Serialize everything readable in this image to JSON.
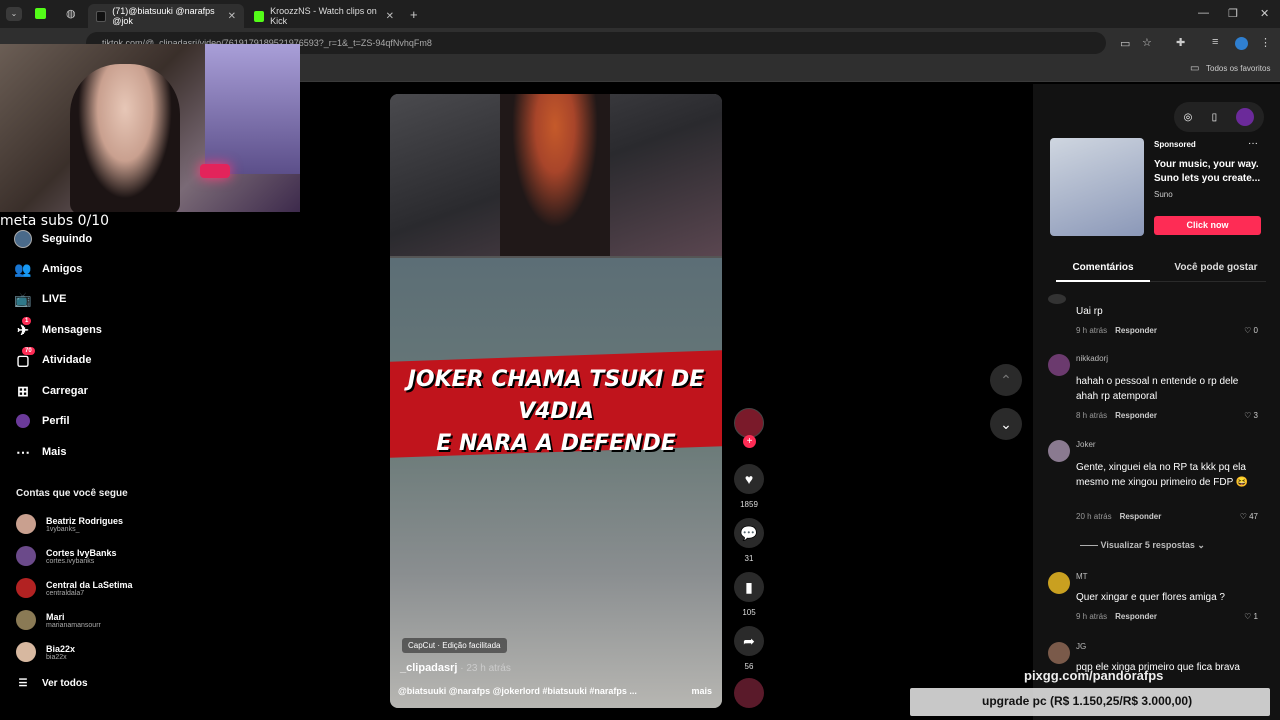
{
  "browser": {
    "tabs": [
      {
        "title": "(71)@biatsuuki @narafps @jok",
        "color": "#1b1b1b"
      },
      {
        "title": "KroozzNS - Watch clips on Kick",
        "color": "#53fc18"
      }
    ],
    "url": "tiktok.com/@_clipadasrj/video/7619179189521976593?_r=1&_t=ZS-94qfNvhqFm8",
    "bookmarks_label": "Todos os favoritos"
  },
  "overlay": {
    "subs_text": "meta subs 0/10",
    "domain_text": "pixgg.com/pandorafps",
    "upgrade_text": "upgrade pc (R$ 1.150,25/R$ 3.000,00)"
  },
  "sidebar": {
    "nav": [
      {
        "label": "Seguindo",
        "icon": "following-icon"
      },
      {
        "label": "Amigos",
        "icon": "friends-icon"
      },
      {
        "label": "LIVE",
        "icon": "live-icon"
      },
      {
        "label": "Mensagens",
        "icon": "messages-icon",
        "badge": "1"
      },
      {
        "label": "Atividade",
        "icon": "activity-icon",
        "badge": "70"
      },
      {
        "label": "Carregar",
        "icon": "upload-icon"
      },
      {
        "label": "Perfil",
        "icon": "profile-icon"
      },
      {
        "label": "Mais",
        "icon": "more-icon"
      }
    ],
    "following_title": "Contas que você segue",
    "accounts": [
      {
        "name": "Beatriz Rodrigues",
        "handle": "1vybanks_",
        "color": "#c9a08f"
      },
      {
        "name": "Cortes IvyBanks",
        "handle": "cortes.ivybanks",
        "color": "#6b4a8a"
      },
      {
        "name": "Central da LaSetima",
        "handle": "centraldala7",
        "color": "#b22222"
      },
      {
        "name": "Mari",
        "handle": "marianamansourr",
        "color": "#8a7a55"
      },
      {
        "name": "Bia22x",
        "handle": "bia22x",
        "color": "#d7b8a0"
      }
    ],
    "see_all": "Ver todos"
  },
  "video": {
    "banner_line1": "JOKER CHAMA TSUKI DE V4DIA",
    "banner_line2": "E NARA A DEFENDE",
    "capcut": "CapCut · Edição facilitada",
    "author": "_clipadasrj",
    "time": " · 23 h atrás",
    "caption": "@biatsuuki @narafps @jokerlord #biatsuuki #narafps ...",
    "more": "mais"
  },
  "actions": {
    "likes": "1859",
    "comments": "31",
    "saves": "105",
    "shares": "56"
  },
  "ad": {
    "sponsored": "Sponsored",
    "title": "Your music, your way. Suno lets you create...",
    "brand": "Suno",
    "cta": "Click now"
  },
  "comments_panel": {
    "tab1": "Comentários",
    "tab2": "Você pode gostar",
    "reply": "Responder",
    "more_replies": "Visualizar 5 respostas",
    "comments": [
      {
        "user": "",
        "text": "Uai rp",
        "time": "9 h atrás",
        "likes": "0",
        "color": "#444"
      },
      {
        "user": "nikkadorj",
        "text": "hahah o pessoal n entende o rp dele ahah rp atemporal",
        "time": "8 h atrás",
        "likes": "3",
        "color": "#6b3a6e"
      },
      {
        "user": "Joker",
        "text": "Gente, xinguei ela no RP ta kkk pq ela mesmo me xingou primeiro de FDP 😆",
        "time": "20 h atrás",
        "likes": "47",
        "color": "#8a7a90"
      },
      {
        "user": "MT",
        "text": "Quer xingar e quer flores amiga ?",
        "time": "9 h atrás",
        "likes": "1",
        "color": "#c9a020"
      },
      {
        "user": "JG",
        "text": "pqp ele xinga primeiro que fica brava",
        "time": "",
        "likes": "",
        "color": "#7a5a4a"
      }
    ]
  }
}
